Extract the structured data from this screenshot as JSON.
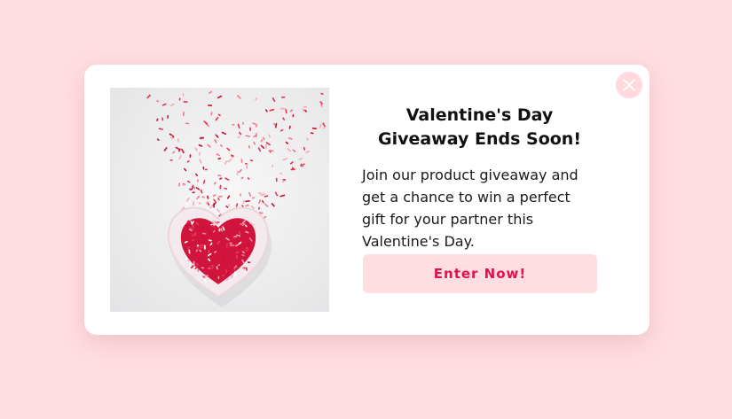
{
  "modal": {
    "title": "Valentine's Day Giveaway Ends Soon!",
    "description": "Join our product giveaway and get a chance to win a perfect gift for your partner this Valentine's Day.",
    "cta_label": "Enter Now!",
    "close_icon": "close-icon",
    "image_subject": "heart-shaped bowl of red sprinkles"
  },
  "colors": {
    "background": "#ffdde1",
    "modal": "#ffffff",
    "accent": "#e0124f",
    "button_bg": "#ffdde1",
    "close_bg": "#ffd9de"
  }
}
